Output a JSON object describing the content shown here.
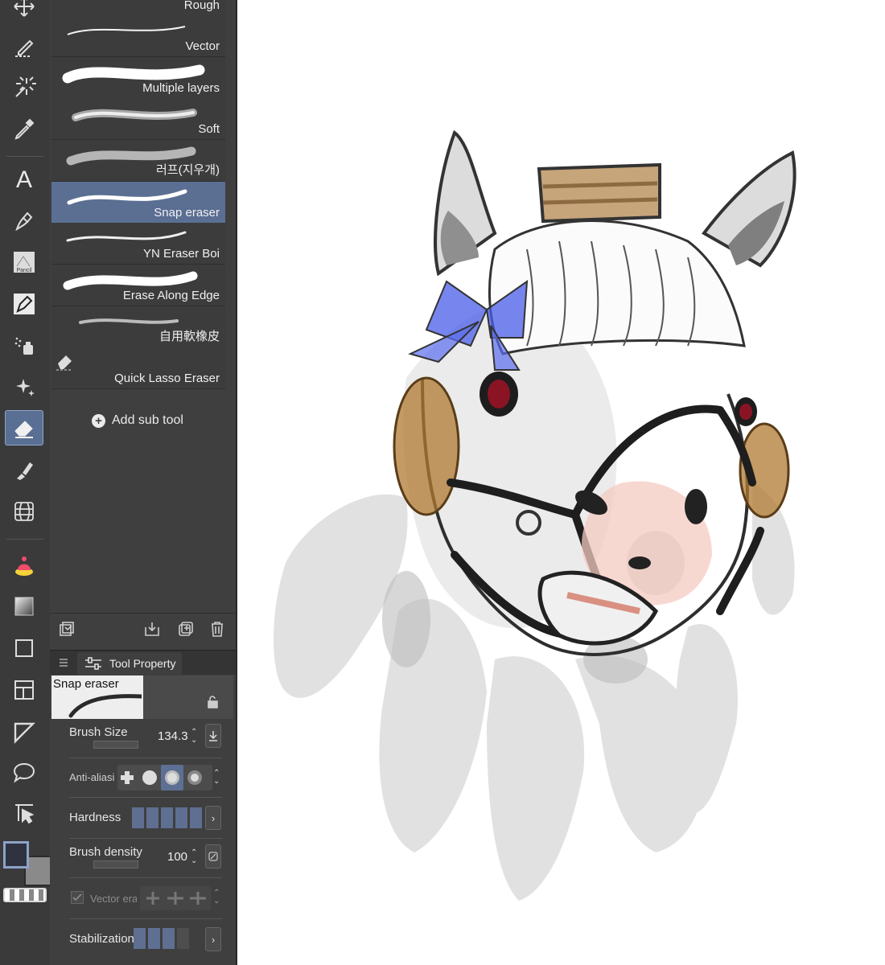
{
  "toolbar": {
    "tools": [
      "move-icon",
      "lasso-select-icon",
      "magic-wand-icon",
      "eyedropper-icon",
      "text-tool-icon",
      "pen-icon",
      "pencil-icon",
      "marker-icon",
      "airbrush-icon",
      "decoration-icon",
      "eraser-icon",
      "blend-icon",
      "figure-icon",
      "fill-icon",
      "gradient-icon",
      "frame-icon",
      "panel-layout-icon",
      "ruler-icon",
      "speech-balloon-icon",
      "operation-icon"
    ],
    "active_tool": "eraser-icon",
    "pencil_tool_label": "Pancil"
  },
  "subtool_panel": {
    "items": [
      {
        "label": "Rough"
      },
      {
        "label": "Vector"
      },
      {
        "label": "Multiple layers"
      },
      {
        "label": "Soft"
      },
      {
        "label": "러프(지우개)"
      },
      {
        "label": "Snap eraser",
        "selected": true
      },
      {
        "label": "YN Eraser Boi"
      },
      {
        "label": "Erase Along Edge"
      },
      {
        "label": "自用軟橡皮"
      },
      {
        "label": "Quick Lasso Eraser"
      }
    ],
    "add_sub_tool_label": "Add sub tool"
  },
  "tool_property": {
    "tab_label": "Tool Property",
    "preview_name": "Snap eraser",
    "brush_size_label": "Brush Size",
    "brush_size_value": "134.3",
    "anti_aliasing_label": "Anti-aliasi",
    "hardness_label": "Hardness",
    "hardness_level": "5 of 5",
    "brush_density_label": "Brush density",
    "brush_density_value": "100",
    "vector_eraser_label": "Vector eras",
    "stabilization_label": "Stabilization",
    "stabilization_level": "3 of 4"
  },
  "colors": {
    "panel_bg": "#3f3f3f",
    "selected_bg": "#5b6f93",
    "main_color": "#2f3340",
    "sub_color": "#8a8a8a"
  }
}
